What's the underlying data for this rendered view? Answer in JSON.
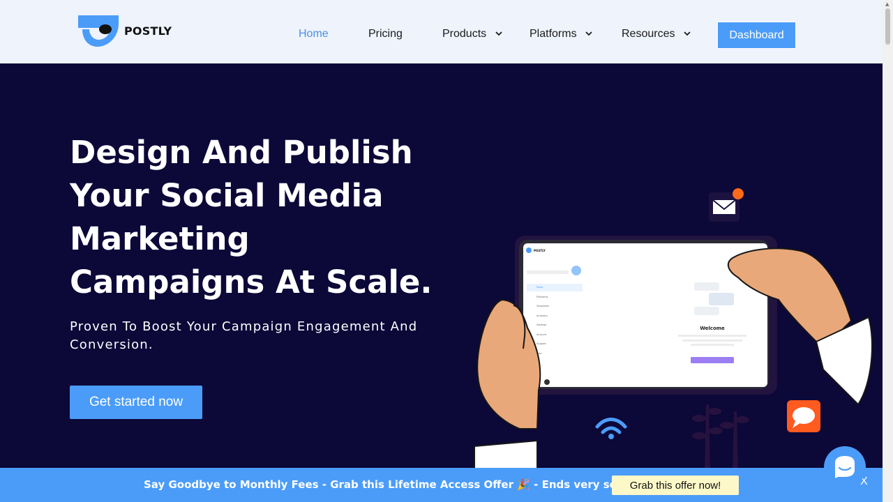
{
  "brand": {
    "name": "POSTLY"
  },
  "nav": {
    "items": [
      {
        "label": "Home",
        "active": true,
        "dropdown": false
      },
      {
        "label": "Pricing",
        "active": false,
        "dropdown": false
      },
      {
        "label": "Products",
        "active": false,
        "dropdown": true
      },
      {
        "label": "Platforms",
        "active": false,
        "dropdown": true
      },
      {
        "label": "Resources",
        "active": false,
        "dropdown": true
      }
    ],
    "dashboard_label": "Dashboard"
  },
  "hero": {
    "title_lines": [
      "Design And Publish",
      "Your Social Media",
      "Marketing",
      "Campaigns At Scale."
    ],
    "subtitle": "Proven To Boost Your Campaign Engagement And Conversion.",
    "cta_label": "Get started now"
  },
  "mockup": {
    "brand": "POSTLY",
    "sidebar": [
      "Posts",
      "Platforms",
      "Templates",
      "Analytics",
      "Settings",
      "Account",
      "Support",
      "Free"
    ],
    "welcome_title": "Welcome",
    "welcome_text": "You are just a click away from scheduling your first post across your selected social platforms",
    "button": "ADD SOCIAL PLATFORMS"
  },
  "banner": {
    "text": "Say Goodbye to Monthly Fees - Grab this Lifetime Access Offer 🎉 - Ends very soon!",
    "button_label": "Grab this offer now!",
    "close_label": "X"
  },
  "colors": {
    "accent": "#4b9cf8",
    "hero_bg": "#0c0838",
    "header_bg": "#eef3fc",
    "active_nav": "#4b8fe2",
    "offer_btn_bg": "#fdf8c8",
    "notification": "#ff6a1a"
  },
  "icons": [
    "logo-icon",
    "chevron-down-icon",
    "mail-icon",
    "wifi-icon",
    "chat-bubble-icon",
    "chat-widget-icon"
  ]
}
